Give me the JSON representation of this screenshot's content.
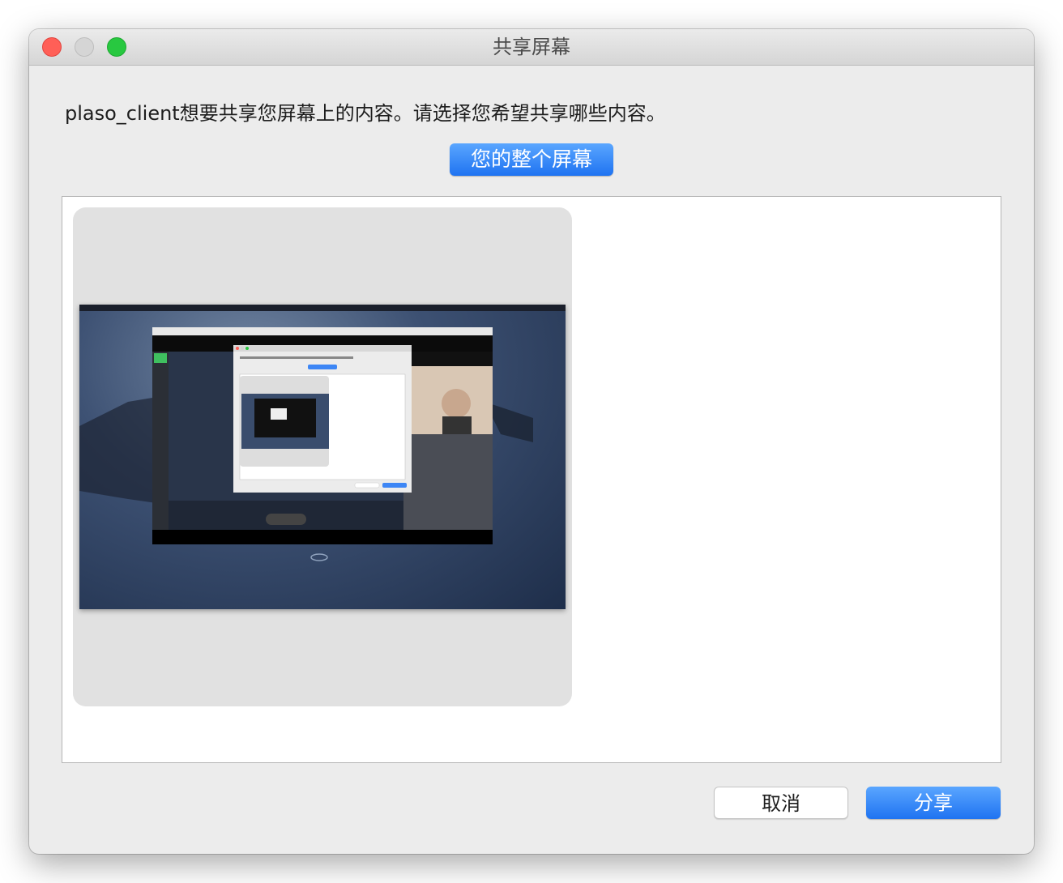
{
  "window": {
    "title": "共享屏幕",
    "traffic_lights": {
      "close_color": "#ff5f57",
      "minimize_color": "#d5d5d5",
      "maximize_color": "#28c840"
    }
  },
  "prompt": {
    "text": "plaso_client想要共享您屏幕上的内容。请选择您希望共享哪些内容。"
  },
  "source_selector": {
    "selected_label": "您的整个屏幕"
  },
  "sources": [
    {
      "type": "screen",
      "selected": true,
      "thumbnail": "desktop-screenshot"
    }
  ],
  "footer": {
    "cancel_label": "取消",
    "share_label": "分享"
  },
  "colors": {
    "accent": "#1f73f1",
    "window_bg": "#ececec"
  }
}
